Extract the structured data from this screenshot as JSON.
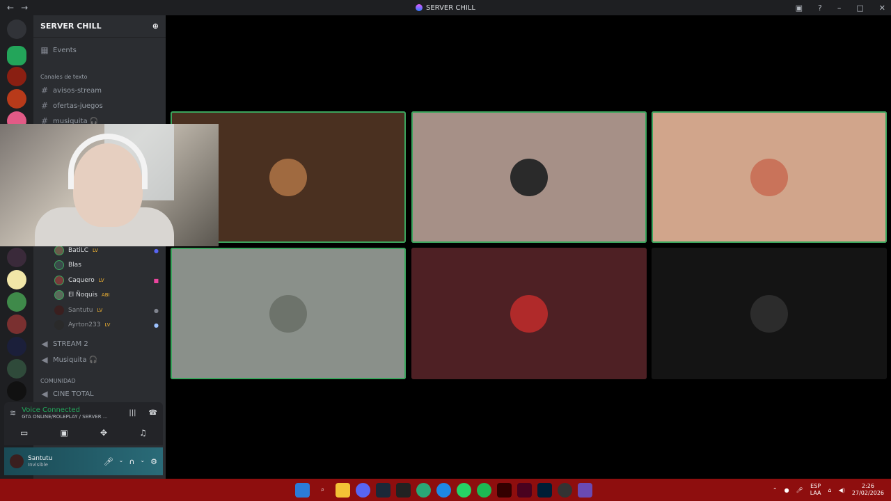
{
  "window": {
    "title": "SERVER CHILL"
  },
  "server": {
    "name": "SERVER CHILL"
  },
  "channels": {
    "events_label": "Events",
    "text_category": "Canales de texto",
    "text_channels": [
      "avisos-stream",
      "ofertas-juegos",
      "musiquita 🎧"
    ],
    "voice_members": [
      {
        "name": "BatiLC",
        "badge": "LV"
      },
      {
        "name": "Blas",
        "badge": ""
      },
      {
        "name": "Caquero",
        "badge": "LV"
      },
      {
        "name": "El Ñoquis",
        "badge": "ABI"
      },
      {
        "name": "Santutu",
        "badge": "LV"
      },
      {
        "name": "Ayrton233",
        "badge": "LV"
      }
    ],
    "voice_channels": [
      "STREAM 2",
      "Musiquita 🎧"
    ],
    "community_category": "COMUNIDAD",
    "community_channel": "CINE TOTAL"
  },
  "voice_panel": {
    "status": "Voice Connected",
    "location": "GTA ONLINE/ROLEPLAY / SERVER ..."
  },
  "user": {
    "name": "Santutu",
    "status": "Invisible"
  },
  "tiles": [
    {
      "bg": "#4a3020",
      "avatar": "#a06a40",
      "speaking": true
    },
    {
      "bg": "#a69087",
      "avatar": "#2a2a2a",
      "speaking": true
    },
    {
      "bg": "#d1a58b",
      "avatar": "#c9735a",
      "speaking": true
    },
    {
      "bg": "#8a908a",
      "avatar": "#6d736b",
      "speaking": true
    },
    {
      "bg": "#4e2024",
      "avatar": "#b02a2a",
      "speaking": false
    },
    {
      "bg": "#141414",
      "avatar": "#2c2c2c",
      "speaking": false
    }
  ],
  "tray": {
    "lang": "ESP",
    "layout": "LAA",
    "time": "2:26",
    "date": "27/02/2026"
  }
}
